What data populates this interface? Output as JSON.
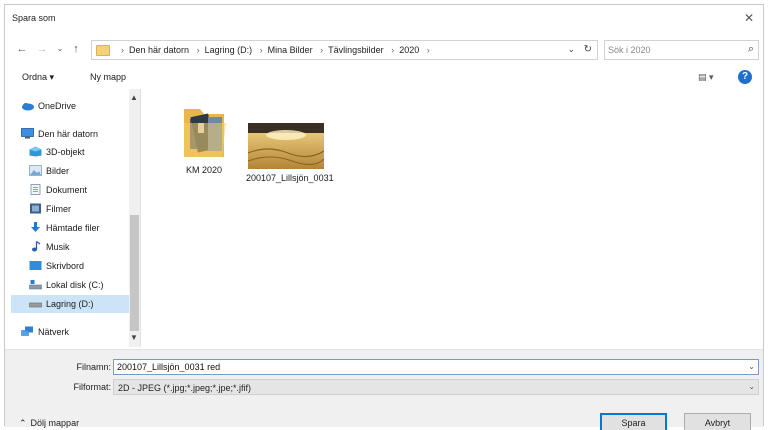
{
  "window": {
    "title": "Spara som",
    "close_glyph": "✕"
  },
  "address": {
    "crumbs": [
      "Den här datorn",
      "Lagring (D:)",
      "Mina Bilder",
      "Tävlingsbilder",
      "2020"
    ],
    "search_placeholder": "Sök i 2020"
  },
  "toolbar": {
    "ordna": "Ordna ▾",
    "ny_mapp": "Ny mapp",
    "view_glyph": "▤ ▾",
    "help_glyph": "?"
  },
  "sidebar": {
    "items": [
      {
        "label": "OneDrive",
        "icon": "onedrive-icon",
        "color": "#2b7cd3"
      },
      {
        "label": "Den här datorn",
        "icon": "computer-icon",
        "color": "#3d8ee0"
      },
      {
        "label": "3D-objekt",
        "icon": "3d-objects-icon",
        "color": "#2a9ad6"
      },
      {
        "label": "Bilder",
        "icon": "pictures-icon",
        "color": "#7aa7cf"
      },
      {
        "label": "Dokument",
        "icon": "documents-icon",
        "color": "#6d8fb3"
      },
      {
        "label": "Filmer",
        "icon": "videos-icon",
        "color": "#3b5f86"
      },
      {
        "label": "Hämtade filer",
        "icon": "downloads-icon",
        "color": "#1f7ad6"
      },
      {
        "label": "Musik",
        "icon": "music-icon",
        "color": "#2a5fa8"
      },
      {
        "label": "Skrivbord",
        "icon": "desktop-icon",
        "color": "#2c8ee0"
      },
      {
        "label": "Lokal disk (C:)",
        "icon": "drive-c-icon",
        "color": "#5a7c9a"
      },
      {
        "label": "Lagring (D:)",
        "icon": "drive-d-icon",
        "color": "#6b6b6b"
      },
      {
        "label": "Nätverk",
        "icon": "network-icon",
        "color": "#2f7fd0"
      }
    ],
    "selected_index": 10
  },
  "files": [
    {
      "name": "KM 2020",
      "type": "folder"
    },
    {
      "name": "200107_Lillsjön_0031",
      "type": "image"
    }
  ],
  "form": {
    "filename_label": "Filnamn:",
    "filename_value": "200107_Lillsjön_0031 red",
    "format_label": "Filformat:",
    "format_value": "2D - JPEG (*.jpg;*.jpeg;*.jpe;*.jfif)"
  },
  "footer": {
    "hide_folders": "Dölj mappar",
    "save": "Spara",
    "cancel": "Avbryt"
  }
}
